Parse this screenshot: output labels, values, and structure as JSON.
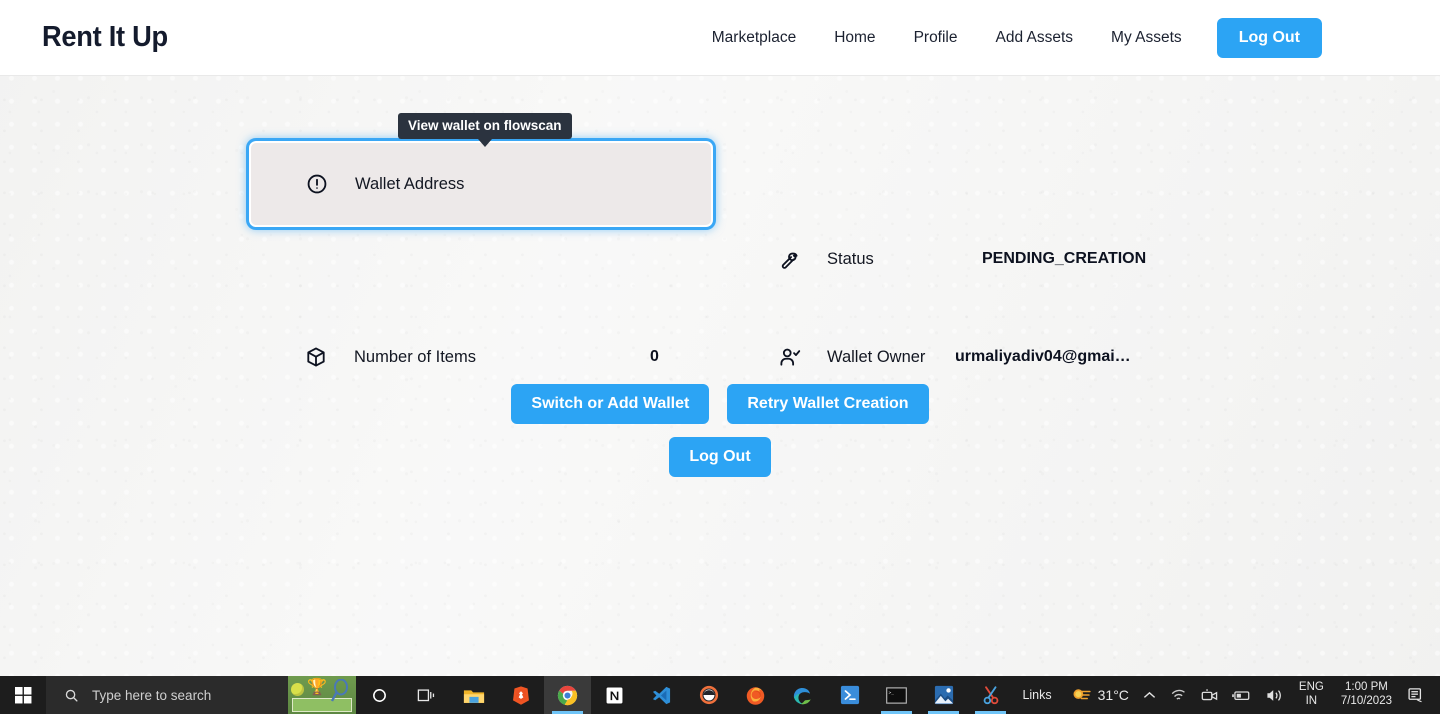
{
  "header": {
    "logo": "Rent It Up",
    "nav": [
      {
        "label": "Marketplace",
        "name": "nav-marketplace"
      },
      {
        "label": "Home",
        "name": "nav-home"
      },
      {
        "label": "Profile",
        "name": "nav-profile"
      },
      {
        "label": "Add Assets",
        "name": "nav-add-assets"
      },
      {
        "label": "My Assets",
        "name": "nav-my-assets"
      }
    ],
    "logout_label": "Log Out",
    "accent_color": "#2ca4f4",
    "logo_color": "#141b2d"
  },
  "tooltip": {
    "text": "View wallet on flowscan",
    "background": "#2b333f",
    "text_color": "#ffffff"
  },
  "wallet": {
    "address_label": "Wallet Address",
    "address_icon": "alert-circle-icon",
    "card_background": "#ede9e9",
    "focus_ring_color": "#3aa7f5",
    "status_label": "Status",
    "status_icon": "wrench-icon",
    "status_value": "PENDING_CREATION",
    "items_label": "Number of Items",
    "items_icon": "package-icon",
    "items_value": "0",
    "owner_label": "Wallet Owner",
    "owner_icon": "user-check-icon",
    "owner_value": "urmaliyadiv04@gmai…"
  },
  "actions": {
    "switch_wallet": "Switch or Add Wallet",
    "retry_wallet": "Retry Wallet Creation",
    "log_out": "Log Out"
  },
  "taskbar": {
    "start_icon": "windows-logo-icon",
    "search_placeholder": "Type here to search",
    "search_icon": "search-icon",
    "icons": [
      {
        "name": "cortana-icon",
        "open": false
      },
      {
        "name": "task-view-icon",
        "open": false
      },
      {
        "name": "file-explorer-icon",
        "open": false
      },
      {
        "name": "brave-browser-icon",
        "open": false
      },
      {
        "name": "google-chrome-icon",
        "open": true,
        "active": true
      },
      {
        "name": "notion-icon",
        "open": false
      },
      {
        "name": "vs-code-icon",
        "open": true
      },
      {
        "name": "postman-icon",
        "open": false
      },
      {
        "name": "firefox-icon",
        "open": false
      },
      {
        "name": "microsoft-edge-icon",
        "open": false
      },
      {
        "name": "powershell-icon",
        "open": false
      },
      {
        "name": "command-prompt-icon",
        "open": true
      },
      {
        "name": "photos-icon",
        "open": true
      },
      {
        "name": "snipping-tool-icon",
        "open": true
      }
    ],
    "tray": {
      "links_label": "Links",
      "weather_icon": "weather-sun-icon",
      "temperature": "31°C",
      "chevron_icon": "chevron-up-icon",
      "wifi_icon": "wifi-icon",
      "meet-now_icon": "meet-now-icon",
      "battery_icon": "battery-icon",
      "volume_icon": "volume-icon",
      "language_line1": "ENG",
      "language_line2": "IN",
      "time": "1:00 PM",
      "date": "7/10/2023",
      "notification_icon": "notification-icon"
    }
  }
}
